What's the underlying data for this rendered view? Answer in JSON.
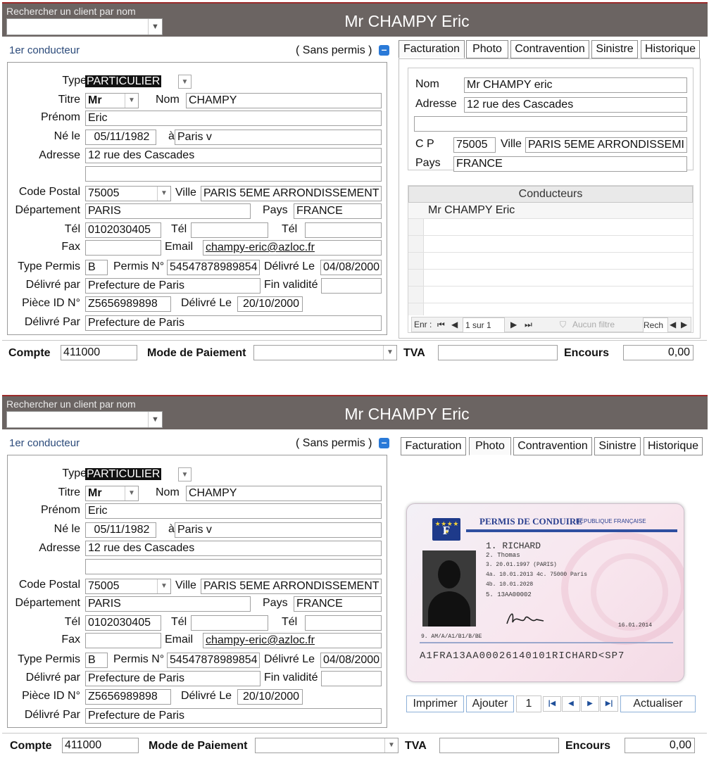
{
  "header": {
    "search_label": "Rechercher un client par nom",
    "title": "Mr CHAMPY Eric"
  },
  "section": {
    "conducteur_label": "1er conducteur",
    "sans_permis": "( Sans permis )"
  },
  "labels": {
    "type": "Type",
    "titre": "Titre",
    "nom": "Nom",
    "prenom": "Prénom",
    "ne_le": "Né le",
    "a": "à",
    "adresse": "Adresse",
    "code_postal": "Code Postal",
    "ville": "Ville",
    "departement": "Département",
    "pays": "Pays",
    "tel": "Tél",
    "fax": "Fax",
    "email": "Email",
    "type_permis": "Type Permis",
    "permis_no": "Permis N°",
    "delivre_le": "Délivré Le",
    "delivre_par": "Délivré par",
    "fin_validite": "Fin validité",
    "piece_id": "Pièce ID N°",
    "delivre_par_2": "Délivré Par"
  },
  "form": {
    "type": "PARTICULIER",
    "titre": "Mr",
    "nom": "CHAMPY",
    "prenom": "Eric",
    "ne_le": "05/11/1982",
    "lieu_naissance": "Paris v",
    "adresse1": "12 rue des Cascades",
    "adresse2": "",
    "code_postal": "75005",
    "ville": "PARIS 5EME ARRONDISSEMENT",
    "departement": "PARIS",
    "pays": "FRANCE",
    "tel1": "0102030405",
    "tel2": "",
    "tel3": "",
    "fax": "",
    "email": "champy-eric@azloc.fr",
    "type_permis": "B",
    "permis_no": "54547878989854",
    "permis_delivre_le": "04/08/2000",
    "permis_delivre_par": "Prefecture de Paris",
    "fin_validite": "",
    "piece_id": "Z5656989898",
    "piece_delivre_le": "20/10/2000",
    "piece_delivre_par": "Prefecture de Paris"
  },
  "tabs": [
    "Facturation",
    "Photo",
    "Contravention",
    "Sinistre",
    "Historique"
  ],
  "facturation": {
    "nom_label": "Nom",
    "nom": "Mr CHAMPY eric",
    "adresse_label": "Adresse",
    "adresse1": "12 rue des Cascades",
    "adresse2": "",
    "cp_label": "C P",
    "cp": "75005",
    "ville_label": "Ville",
    "ville": "PARIS 5EME ARRONDISSEMI",
    "pays_label": "Pays",
    "pays": "FRANCE"
  },
  "conducteurs": {
    "header": "Conducteurs",
    "rows": [
      "Mr CHAMPY Eric"
    ],
    "nav": {
      "enr": "Enr :",
      "pos": "1 sur 1",
      "filter": "Aucun filtre",
      "search": "Rech"
    }
  },
  "bottom": {
    "compte_label": "Compte",
    "compte": "411000",
    "mode_label": "Mode de Paiement",
    "mode": "",
    "tva_label": "TVA",
    "tva": "",
    "encours_label": "Encours",
    "encours": "0,00"
  },
  "photo": {
    "buttons": {
      "imprimer": "Imprimer",
      "ajouter": "Ajouter",
      "page": "1",
      "actualiser": "Actualiser"
    },
    "card": {
      "flag_letter": "F",
      "title": "PERMIS DE CONDUIRE",
      "republique": "RÉPUBLIQUE FRANÇAISE",
      "line1": "1. RICHARD",
      "line2": "2. Thomas",
      "line3": "3. 20.01.1997 (PARIS)",
      "line4": "4a. 10.01.2013",
      "line4c": "4c. 75000 Paris",
      "line4b": "4b. 10.01.2028",
      "line5": "5. 13AA00002",
      "line9": "9. AM/A/A1/B1/B/BE",
      "date": "16.01.2014",
      "mrz": "A1FRA13AA00026140101RICHARD<SP7"
    }
  }
}
